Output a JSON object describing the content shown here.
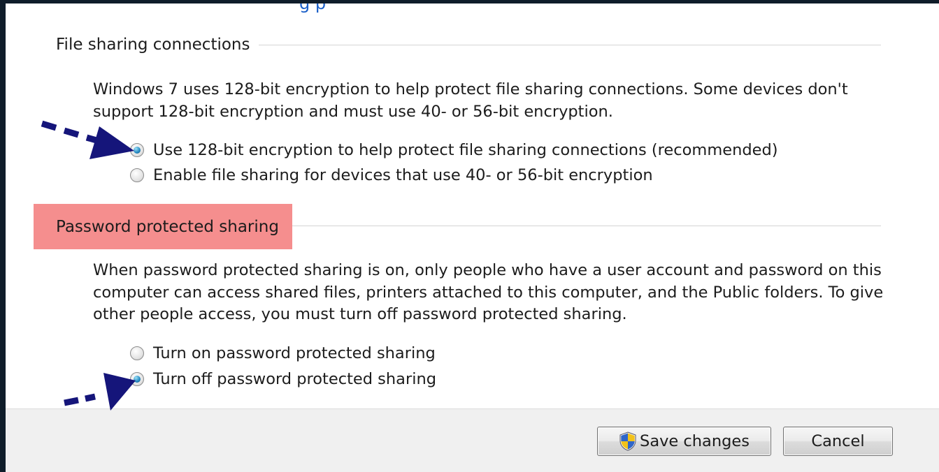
{
  "top_link_fragment": "g p",
  "file_sharing": {
    "header": "File sharing connections",
    "description": "Windows 7 uses 128-bit encryption to help protect file sharing connections. Some devices don't support 128-bit encryption and must use 40- or 56-bit encryption.",
    "options": [
      {
        "label": "Use 128-bit encryption to help protect file sharing connections (recommended)",
        "checked": true
      },
      {
        "label": "Enable file sharing for devices that use 40- or 56-bit encryption",
        "checked": false
      }
    ]
  },
  "password_sharing": {
    "header": "Password protected sharing",
    "description": "When password protected sharing is on, only people who have a user account and password on this computer can access shared files, printers attached to this computer, and the Public folders. To give other people access, you must turn off password protected sharing.",
    "options": [
      {
        "label": "Turn on password protected sharing",
        "checked": false
      },
      {
        "label": "Turn off password protected sharing",
        "checked": true
      }
    ]
  },
  "buttons": {
    "save": "Save changes",
    "cancel": "Cancel"
  },
  "icons": {
    "save": "uac-shield-icon",
    "annotation": "dashed-arrow-icon"
  },
  "colors": {
    "highlight": "#f58e8e",
    "annotation_arrow": "#15157a",
    "radio_selected": "#2b8fc6"
  }
}
